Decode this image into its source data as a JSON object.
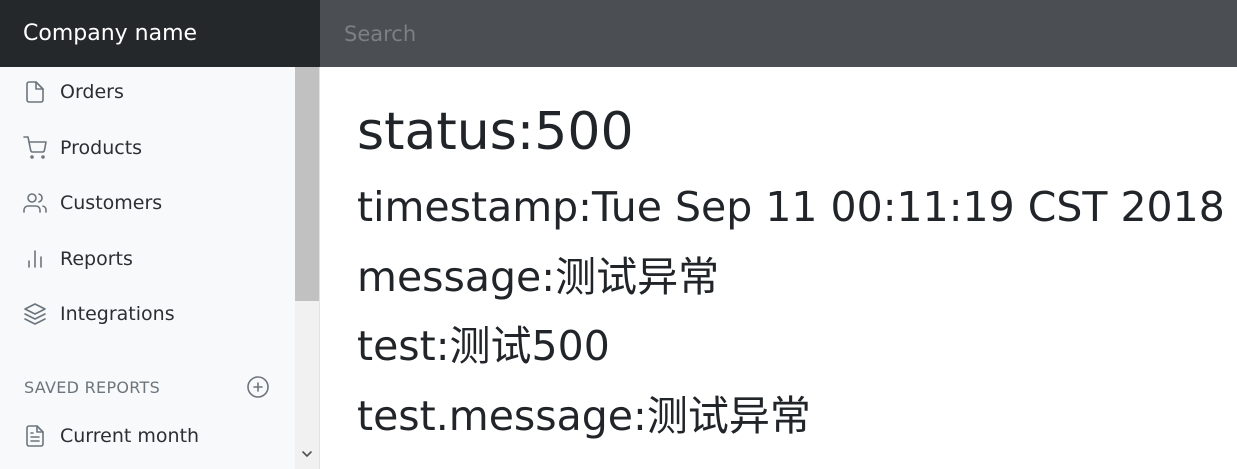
{
  "navbar": {
    "brand": "Company name",
    "search_placeholder": "Search"
  },
  "sidebar": {
    "items": [
      {
        "label": "Orders",
        "icon": "file-icon"
      },
      {
        "label": "Products",
        "icon": "shopping-cart-icon"
      },
      {
        "label": "Customers",
        "icon": "users-icon"
      },
      {
        "label": "Reports",
        "icon": "bar-chart-icon"
      },
      {
        "label": "Integrations",
        "icon": "layers-icon"
      }
    ],
    "saved_reports": {
      "heading": "SAVED REPORTS",
      "add_icon": "plus-circle-icon",
      "items": [
        {
          "label": "Current month",
          "icon": "file-text-icon"
        }
      ]
    }
  },
  "main": {
    "status": "status:500",
    "lines": [
      "timestamp:Tue Sep 11 00:11:19 CST 2018",
      "message:测试异常",
      "test:测试500",
      "test.message:测试异常"
    ]
  }
}
